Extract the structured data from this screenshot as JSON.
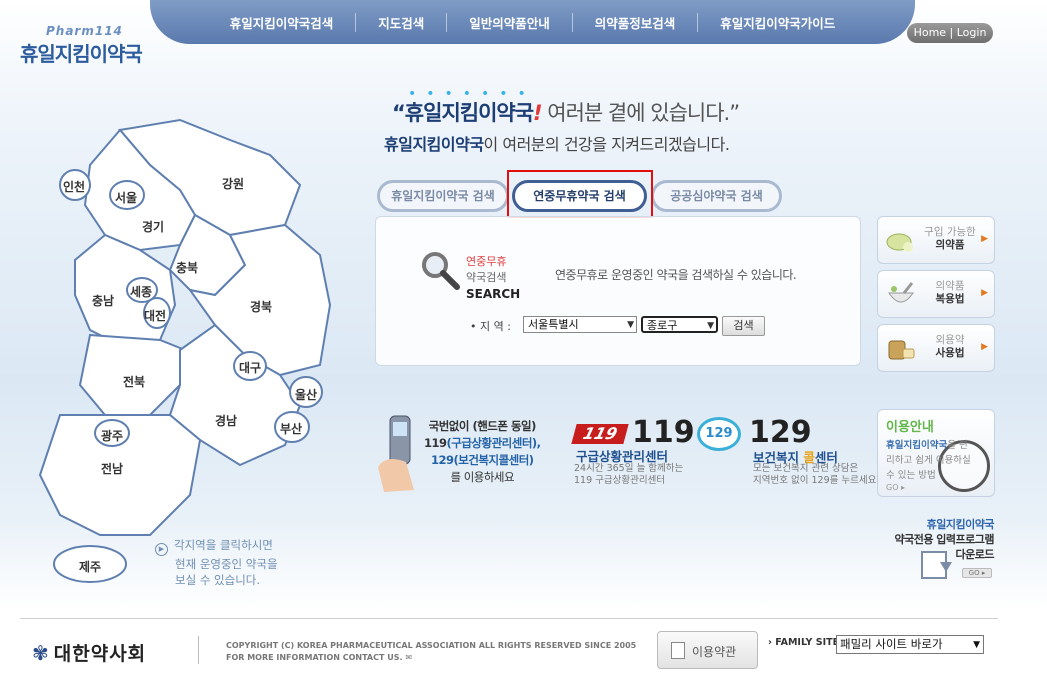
{
  "header": {
    "logo_sub": "Pharm114",
    "logo_main": "휴일지킴이약국",
    "nav": [
      "휴일지킴이약국검색",
      "지도검색",
      "일반의약품안내",
      "의약품정보검색",
      "휴일지킴이약국가이드"
    ],
    "home_login": "Home | Login"
  },
  "slogan": {
    "line1_bold": "“휴일지킴이약국",
    "line1_bang": "!",
    "line1_rest": " 여러분 곁에 있습니다.”",
    "line2_bold": "휴일지킴이약국",
    "line2_rest": "이 여러분의 건강을 지켜드리겠습니다."
  },
  "tabs": [
    "휴일지킴이약국 검색",
    "연중무휴약국 검색",
    "공공심야약국 검색"
  ],
  "active_tab": 1,
  "search": {
    "title_red": "연중무휴",
    "title_gray": "약국검색",
    "title_en": "SEARCH",
    "description": "연중무휴로 운영중인 약국을 검색하실 수 있습니다.",
    "region_label": "• 지 역 :",
    "city_value": "서울특별시",
    "district_value": "종로구",
    "button": "검색"
  },
  "side_links": [
    {
      "line1": "구입 가능한",
      "line2": "의약품"
    },
    {
      "line1": "의약품",
      "line2": "복용법"
    },
    {
      "line1": "외용약",
      "line2": "사용법"
    }
  ],
  "map": {
    "regions": [
      "인천",
      "서울",
      "강원",
      "경기",
      "충북",
      "세종",
      "충남",
      "대전",
      "경북",
      "대구",
      "울산",
      "전북",
      "경남",
      "광주",
      "부산",
      "전남",
      "제주"
    ],
    "note": [
      "각지역을 클릭하시면",
      "현재 운영중인 약국을",
      "보실 수 있습니다."
    ]
  },
  "info": {
    "phone_line1": "국번없이 (핸드폰 동일)",
    "phone_line2_num": "119",
    "phone_line2_rest": "(구급상황관리센터),",
    "phone_line3": "129(보건복지콜센터)",
    "phone_line4": "를 이용하세요",
    "badge119": "119",
    "num119": "119",
    "title119": "구급상황관리센터",
    "desc119": [
      "24시간 365일 늘 함께하는",
      "119 구급상황관리센터"
    ],
    "badge129": "129",
    "num129": "129",
    "title129_a": "보건복지 ",
    "title129_b": "콜",
    "title129_c": "센터",
    "desc129": [
      "모든 보건복지 관련 상담은",
      "지역번호 없이 129를 누르세요."
    ]
  },
  "guide": {
    "title": "이용안내",
    "text_bold": "휴일지킴이약국",
    "text_rest": "을 편리하고 쉽게 이용하실 수 있는 방법",
    "go": "GO ▸"
  },
  "program": {
    "line1": "휴일지킴이약국",
    "line2": "약국전용 입력프로그램",
    "line3": "다운로드",
    "go": "GO ▸"
  },
  "footer": {
    "logo": "대한약사회",
    "copyright1": "COPYRIGHT (C) KOREA PHARMACEUTICAL ASSOCIATION ALL RIGHTS RESERVED SINCE 2005",
    "copyright2": "FOR MORE INFORMATION CONTACT US.",
    "terms": "이용약관",
    "family_label": "› FAMILY SITE",
    "family_value": "패밀리 사이트 바로가"
  },
  "colors": {
    "nav_bg": "#5a79ad",
    "accent_blue": "#1c3e75",
    "highlight_red": "#e01010"
  }
}
